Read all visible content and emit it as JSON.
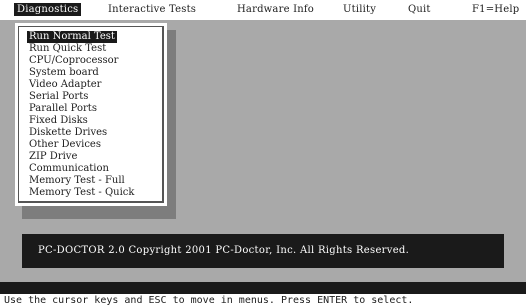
{
  "menubar": {
    "items": [
      {
        "label": "Diagnostics",
        "active": true
      },
      {
        "label": "Interactive Tests",
        "active": false
      },
      {
        "label": "Hardware Info",
        "active": false
      },
      {
        "label": "Utility",
        "active": false
      },
      {
        "label": "Quit",
        "active": false
      }
    ],
    "help": "F1=Help"
  },
  "dropdown": {
    "items": [
      "Run Normal Test",
      "Run Quick Test",
      "CPU/Coprocessor",
      "System board",
      "Video Adapter",
      "Serial Ports",
      "Parallel Ports",
      "Fixed Disks",
      "Diskette Drives",
      "Other Devices",
      "ZIP Drive",
      "Communication",
      "Memory Test - Full",
      "Memory Test - Quick"
    ],
    "selected_index": 0
  },
  "copyright": "PC-DOCTOR 2.0 Copyright 2001 PC-Doctor, Inc. All Rights Reserved.",
  "status": "Use the cursor keys and ESC to move in menus. Press ENTER to select.",
  "colors": {
    "background": "#a9a9a9",
    "highlight": "#1a1a1a",
    "panel": "#ffffff"
  }
}
